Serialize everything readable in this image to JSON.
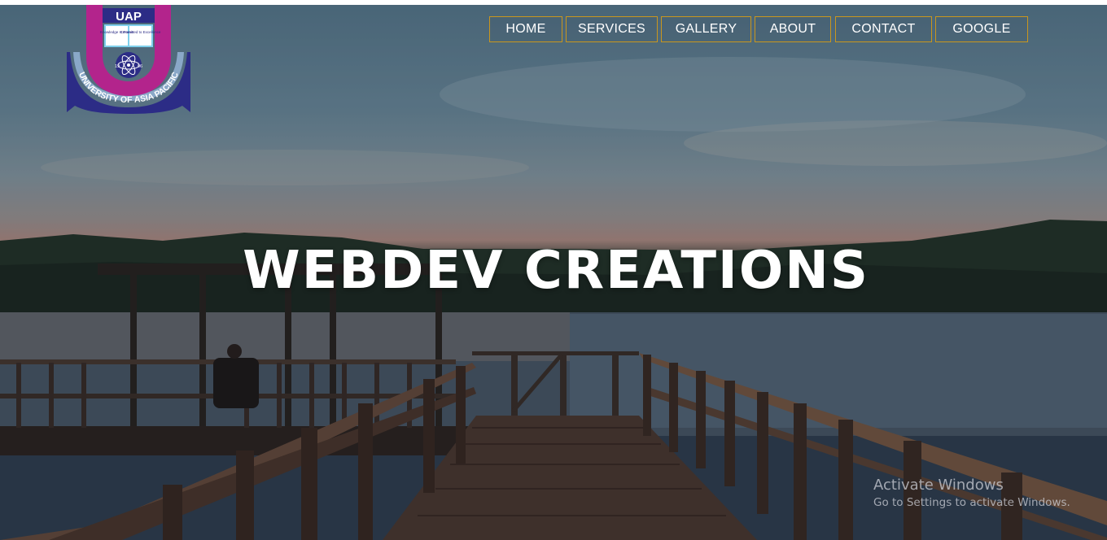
{
  "logo": {
    "acronym": "UAP",
    "book_left": "Knowledge Is Power",
    "book_right": "Committed to Excellence",
    "year_left": "19",
    "year_right": "96",
    "ribbon_text": "UNIVERSITY OF ASIA PACIFIC",
    "colors": {
      "magenta": "#b3248c",
      "navy": "#2c2c86",
      "cyan": "#7fd0ec"
    }
  },
  "nav": {
    "items": [
      {
        "label": "HOME"
      },
      {
        "label": "SERVICES"
      },
      {
        "label": "GALLERY"
      },
      {
        "label": "ABOUT"
      },
      {
        "label": "CONTACT"
      },
      {
        "label": "GOOGLE"
      }
    ],
    "border_color": "#c9961e"
  },
  "hero": {
    "title": "WEBDEV CREATIONS",
    "background_image": "lake-dock-sunset"
  },
  "watermark": {
    "line1": "Activate Windows",
    "line2": "Go to Settings to activate Windows."
  }
}
